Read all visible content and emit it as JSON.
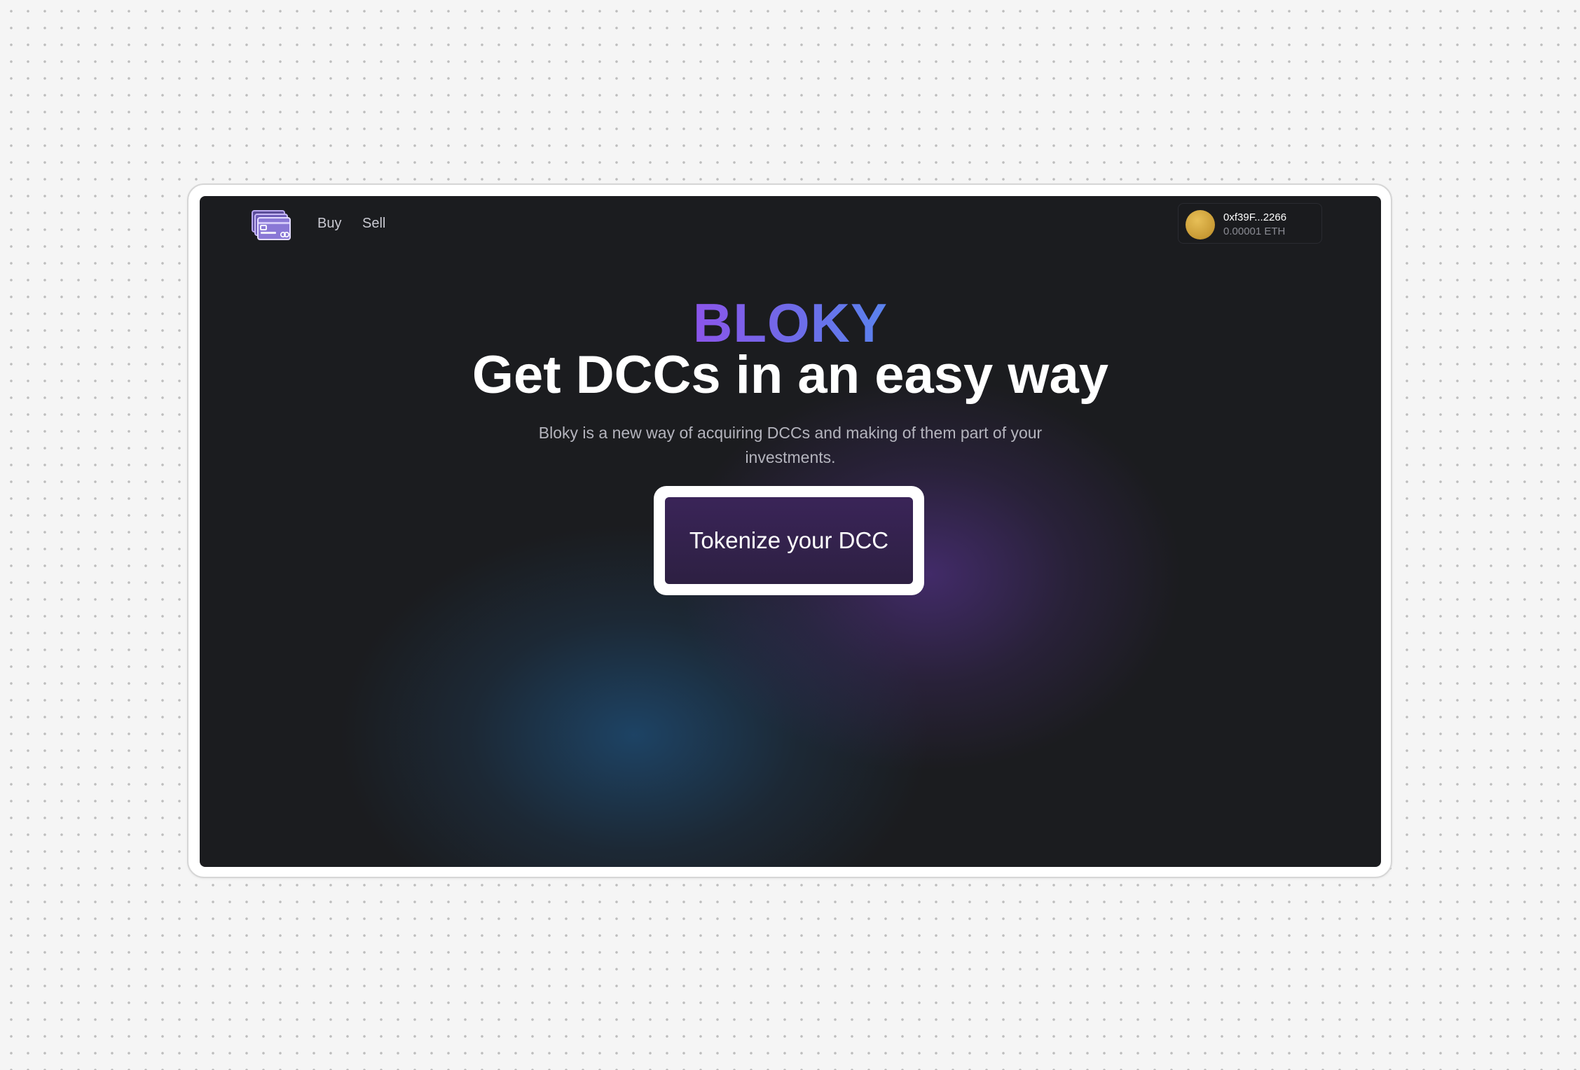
{
  "nav": {
    "logo_icon": "card-wallet-icon",
    "links": [
      {
        "label": "Buy"
      },
      {
        "label": "Sell"
      }
    ]
  },
  "wallet": {
    "address": "0xf39F...2266",
    "balance": "0.00001 ETH",
    "avatar_icon": "wallet-avatar-icon"
  },
  "hero": {
    "brand": "BLOKY",
    "headline": "Get DCCs in an easy way",
    "subtitle": "Bloky is a new way of acquiring DCCs and making of them part of your investments.",
    "cta_label": "Tokenize your DCC"
  },
  "colors": {
    "app_background": "#1b1c1f",
    "brand_gradient_start": "#8c55ea",
    "brand_gradient_end": "#5a83ee",
    "cta_background": "#3a2458",
    "wallet_avatar": "#d9ad45"
  }
}
